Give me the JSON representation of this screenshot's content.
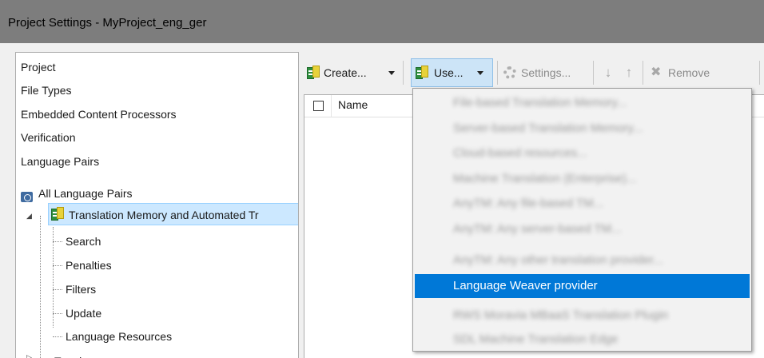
{
  "window": {
    "title": "Project Settings - MyProject_eng_ger"
  },
  "tree": {
    "items": [
      "Project",
      "File Types",
      "Embedded Content Processors",
      "Verification",
      "Language Pairs"
    ],
    "all_language_pairs": "All Language Pairs",
    "tm_node": "Translation Memory and Automated Tr",
    "tm_children": [
      "Search",
      "Penalties",
      "Filters",
      "Update",
      "Language Resources"
    ],
    "termbases": "Termbases"
  },
  "toolbar": {
    "create_label": "Create...",
    "use_label": "Use...",
    "settings_label": "Settings...",
    "remove_label": "Remove"
  },
  "list": {
    "name_header": "Name"
  },
  "menu": {
    "items": [
      {
        "label": "File-based Translation Memory...",
        "state": "blurred"
      },
      {
        "label": "Server-based Translation Memory...",
        "state": "blurred"
      },
      {
        "label": "Cloud-based resources...",
        "state": "blurred"
      },
      {
        "label": "Machine Translation (Enterprise)...",
        "state": "blurred"
      },
      {
        "label": "AnyTM: Any file-based TM...",
        "state": "blurred"
      },
      {
        "label": "AnyTM: Any server-based TM...",
        "state": "blurred"
      },
      {
        "label": "AnyTM: Any other translation provider...",
        "state": "blurred"
      },
      {
        "label": "Language Weaver provider",
        "state": "highlighted"
      },
      {
        "label": "RWS Moravia MBaaS Translation Plugin",
        "state": "blurred"
      },
      {
        "label": "SDL Machine Translation Edge",
        "state": "blurred"
      }
    ]
  },
  "colors": {
    "highlight": "#0078d7",
    "selection": "#cce8ff",
    "titlebar": "#7d7d7d"
  }
}
